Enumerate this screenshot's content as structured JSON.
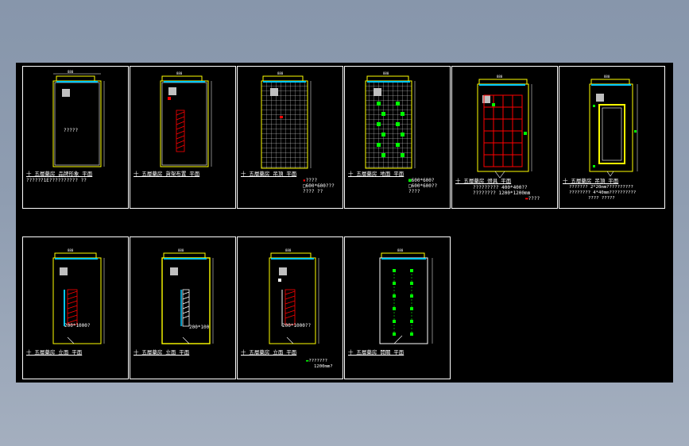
{
  "panels": [
    {
      "caption": "十 五層藥房 品牌形象 平面",
      "subcaption": "??????1E?????????? ??",
      "room_label": "?????"
    },
    {
      "caption": "十 五層藥房 貨架布置 平面"
    },
    {
      "caption": "十 五層藥房 吊頂 平面",
      "notes": [
        "????",
        "600*600???",
        "???? ??"
      ]
    },
    {
      "caption": "十 五層藥房 地面 平面",
      "notes": [
        "600*600?",
        "600*600??",
        "????"
      ]
    },
    {
      "caption": "十 五層藥房 燈具 平面",
      "notes": [
        "?????????  400*400??",
        "????????  1200*1200mm",
        "????"
      ]
    },
    {
      "caption": "十 五層藥房 吊頂 平面",
      "notes": [
        "??????? 2*20mm??????????",
        "???????? 4*40mm??????????",
        "???? ?????"
      ]
    },
    {
      "caption": "十 五層藥房 立面 平面",
      "dim_label": "200*1000?"
    },
    {
      "caption": "十 五層藥房 立面 平面",
      "dim_label": "200*100"
    },
    {
      "caption": "十 五層藥房 立面 平面",
      "dim_label": "200*1000??",
      "notes": [
        "???????",
        "1200mm?"
      ]
    },
    {
      "caption": "十 五層藥房 開關 平面"
    }
  ]
}
